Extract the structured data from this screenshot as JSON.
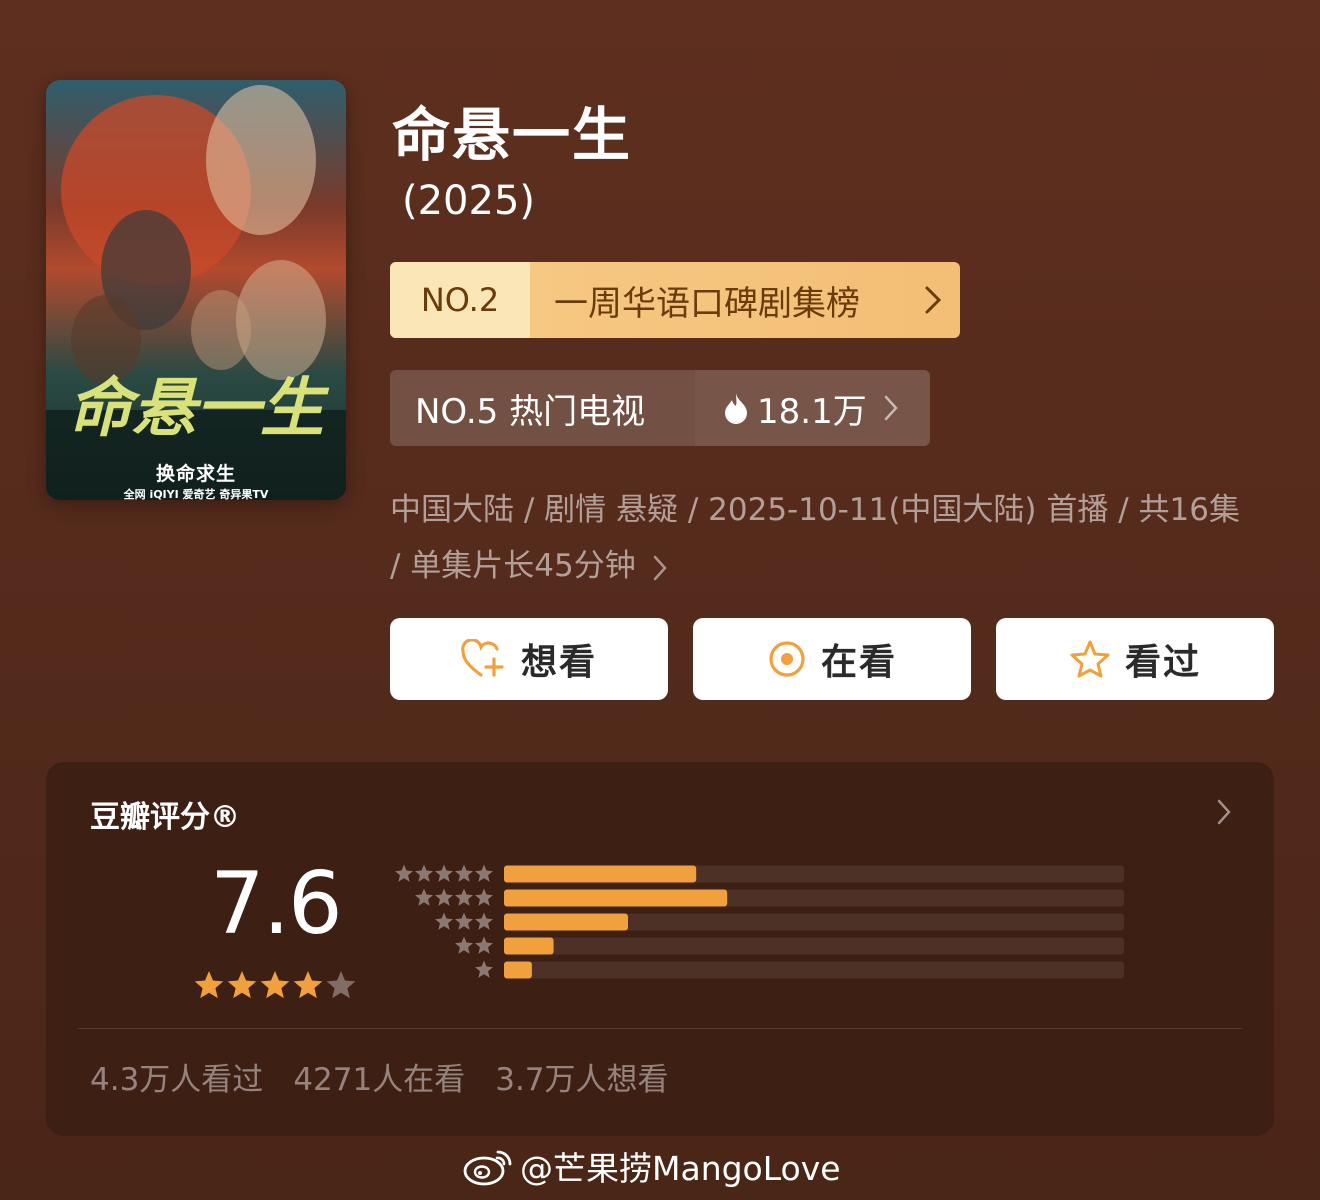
{
  "show": {
    "title": "命悬一生",
    "year": "(2025)",
    "poster": {
      "calligraphy": "命悬一生",
      "tagline": "换命求生",
      "logos": "全网 iQIYI 爱奇艺 奇异果TV"
    }
  },
  "rankings": {
    "primary": {
      "number": "NO.2",
      "label": "一周华语口碑剧集榜"
    },
    "secondary": {
      "label": "NO.5 热门电视",
      "heat": "18.1万"
    }
  },
  "meta": {
    "line": "中国大陆 / 剧情 悬疑 / 2025-10-11(中国大陆) 首播 / 共16集 / 单集片长45分钟"
  },
  "actions": {
    "want": "想看",
    "watching": "在看",
    "watched": "看过"
  },
  "rating": {
    "title": "豆瓣评分®",
    "score": "7.6",
    "stars": 4,
    "distribution": [
      {
        "stars": 5,
        "fraction": 0.31
      },
      {
        "stars": 4,
        "fraction": 0.36
      },
      {
        "stars": 3,
        "fraction": 0.2
      },
      {
        "stars": 2,
        "fraction": 0.08
      },
      {
        "stars": 1,
        "fraction": 0.045
      }
    ],
    "stats": {
      "watched": "4.3万人看过",
      "watching": "4271人在看",
      "want": "3.7万人想看"
    }
  },
  "watermark": "@芒果捞MangoLove",
  "colors": {
    "accent": "#f0a03c",
    "background": "#552b1c",
    "card": "#3e1f14",
    "rank_gold": "#f3be76"
  }
}
